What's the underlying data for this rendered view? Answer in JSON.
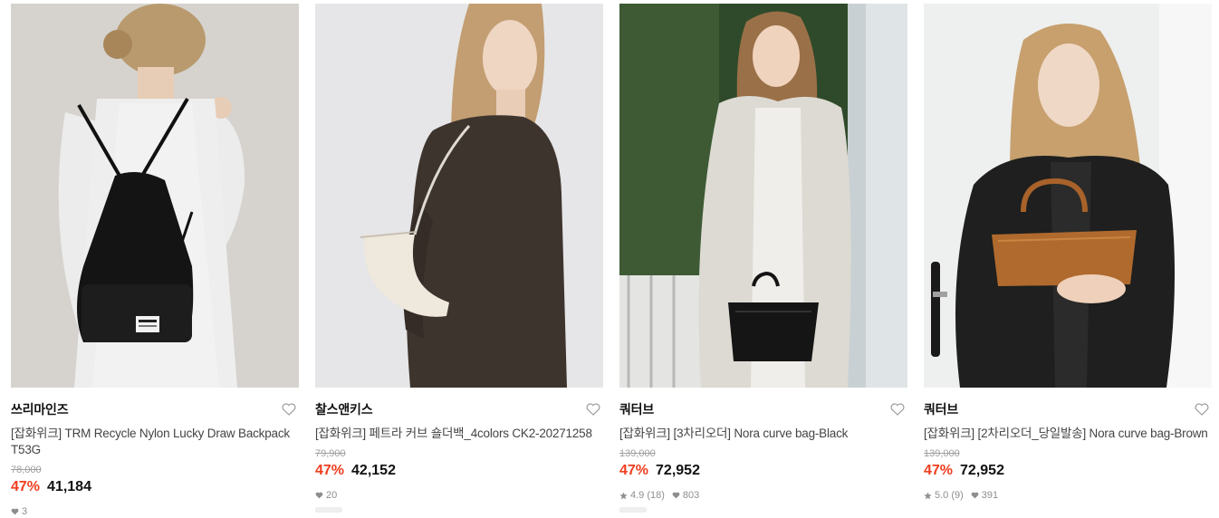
{
  "products": [
    {
      "brand": "쓰리마인즈",
      "name": "[잡화위크] TRM Recycle Nylon Lucky Draw Backpack T53G",
      "original_price": "78,000",
      "discount": "47%",
      "price": "41,184",
      "rating": "",
      "likes": "3",
      "image_icon": "backpack-photo"
    },
    {
      "brand": "찰스앤키스",
      "name": "[잡화위크] 페트라 커브 숄더백_4colors CK2-20271258",
      "original_price": "79,900",
      "discount": "47%",
      "price": "42,152",
      "rating": "",
      "likes": "20",
      "image_icon": "shoulder-bag-photo"
    },
    {
      "brand": "쿼터브",
      "name": "[잡화위크] [3차리오더] Nora curve bag-Black",
      "original_price": "139,000",
      "discount": "47%",
      "price": "72,952",
      "rating": "4.9 (18)",
      "likes": "803",
      "image_icon": "tote-bag-black-photo"
    },
    {
      "brand": "쿼터브",
      "name": "[잡화위크] [2차리오더_당일발송] Nora curve bag-Brown",
      "original_price": "139,000",
      "discount": "47%",
      "price": "72,952",
      "rating": "5.0 (9)",
      "likes": "391",
      "image_icon": "tote-bag-brown-photo"
    }
  ],
  "colors": {
    "discount": "#f03e1f",
    "muted": "#8e8e8e",
    "strike": "#a0a0a0"
  }
}
